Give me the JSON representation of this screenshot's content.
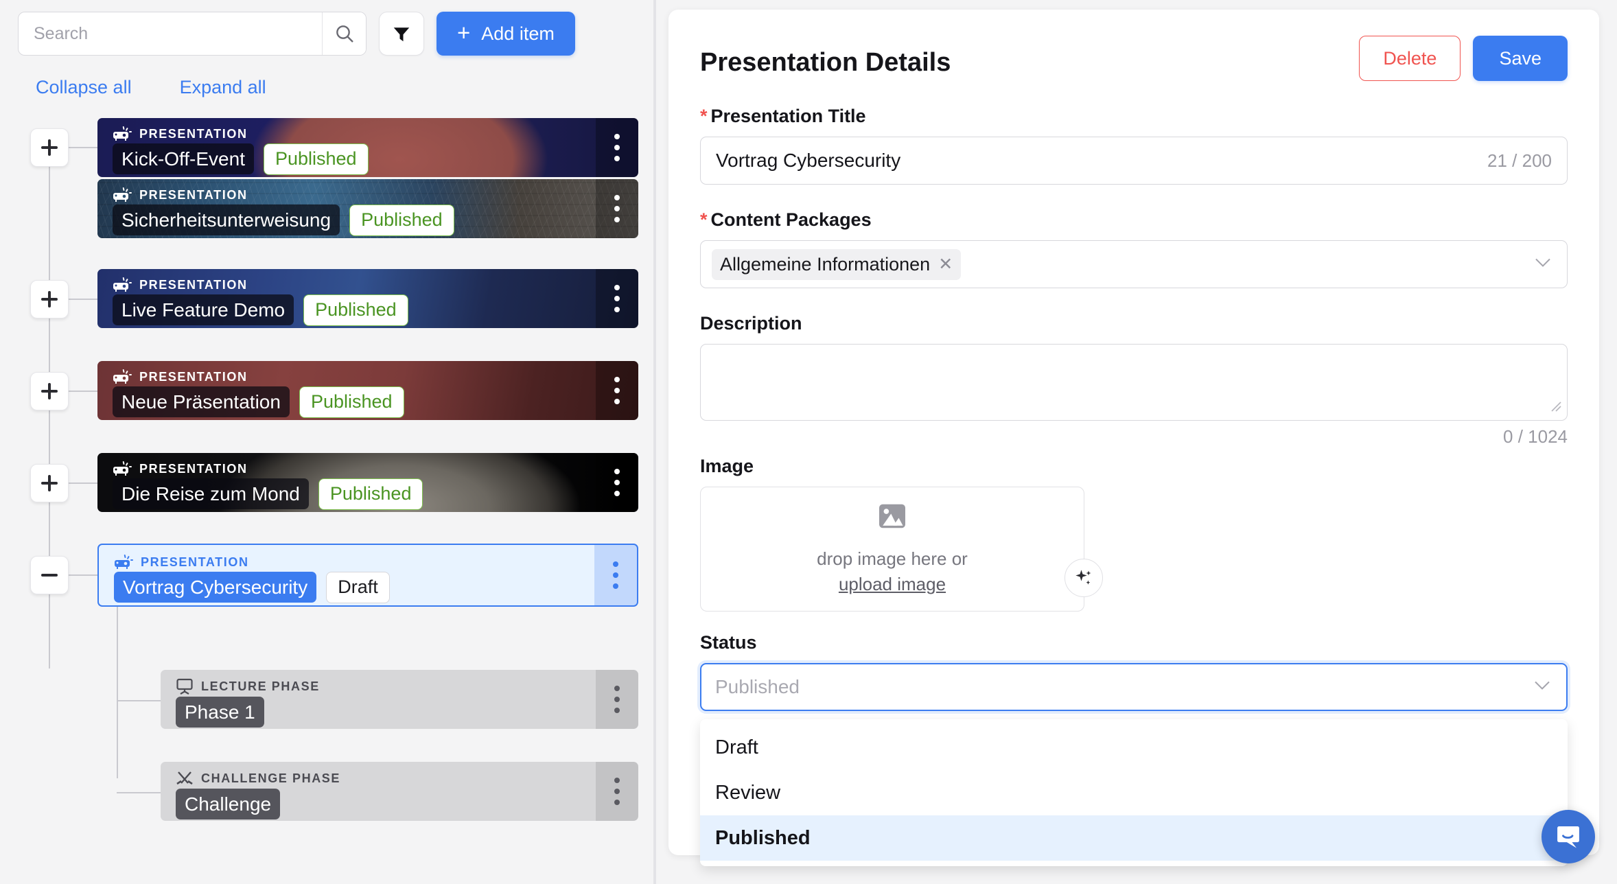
{
  "search": {
    "placeholder": "Search",
    "value": ""
  },
  "toolbar": {
    "filter_label": "Filter",
    "add_item_label": "Add item",
    "add_item_plus": "+"
  },
  "tree_actions": {
    "collapse_all": "Collapse all",
    "expand_all": "Expand all"
  },
  "tree": {
    "items": [
      {
        "kind": "PRESENTATION",
        "title": "Kick-Off-Event",
        "status": "Published",
        "toggle": "plus"
      },
      {
        "kind": "PRESENTATION",
        "title": "Sicherheitsunterweisung",
        "status": "Published",
        "toggle": "none"
      },
      {
        "kind": "PRESENTATION",
        "title": "Live Feature Demo",
        "status": "Published",
        "toggle": "plus"
      },
      {
        "kind": "PRESENTATION",
        "title": "Neue Präsentation",
        "status": "Published",
        "toggle": "plus"
      },
      {
        "kind": "PRESENTATION",
        "title": "Die Reise zum Mond",
        "status": "Published",
        "toggle": "plus"
      },
      {
        "kind": "PRESENTATION",
        "title": "Vortrag Cybersecurity",
        "status": "Draft",
        "toggle": "minus"
      },
      {
        "kind": "LECTURE PHASE",
        "title": "Phase 1",
        "status": "",
        "toggle": "none"
      },
      {
        "kind": "CHALLENGE PHASE",
        "title": "Challenge",
        "status": "",
        "toggle": "none"
      }
    ]
  },
  "detail": {
    "title": "Presentation Details",
    "delete_label": "Delete",
    "save_label": "Save",
    "required_mark": "*",
    "presentation_title": {
      "label": "Presentation Title",
      "value": "Vortrag Cybersecurity",
      "counter": "21 / 200"
    },
    "content_packages": {
      "label": "Content Packages",
      "chips": [
        "Allgemeine Informationen"
      ],
      "chip_remove": "✕"
    },
    "description": {
      "label": "Description",
      "value": "",
      "counter": "0 / 1024"
    },
    "image": {
      "label": "Image",
      "drop_text": "drop image here or",
      "upload_link": "upload image"
    },
    "status": {
      "label": "Status",
      "placeholder": "Published",
      "options": [
        "Draft",
        "Review",
        "Published"
      ],
      "selected": "Published"
    }
  },
  "colors": {
    "accent": "#3b7cf0",
    "danger": "#f0534f",
    "published_green": "#4a9422",
    "published_border": "#7cc04a"
  },
  "chat": {
    "label": "Open chat"
  }
}
